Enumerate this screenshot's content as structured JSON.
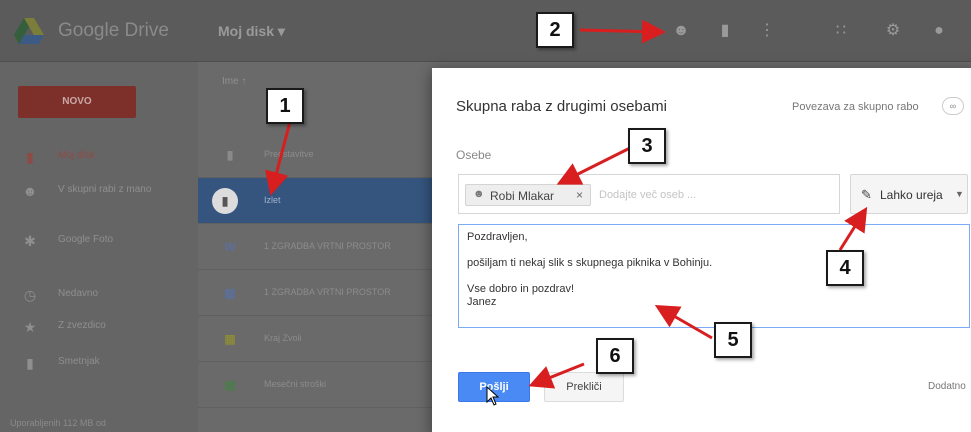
{
  "header": {
    "app_title": "Google Drive",
    "breadcrumb": "Moj disk ▾"
  },
  "sidebar": {
    "new_button": "NOVO",
    "items": [
      {
        "label": "Moj disk",
        "icon": "drive-icon",
        "active": true
      },
      {
        "label": "V skupni rabi z mano",
        "icon": "people-icon",
        "active": false
      },
      {
        "label": "Google Foto",
        "icon": "photos-icon",
        "active": false
      },
      {
        "label": "Nedavno",
        "icon": "clock-icon",
        "active": false
      },
      {
        "label": "Z zvezdico",
        "icon": "star-icon",
        "active": false
      },
      {
        "label": "Smetnjak",
        "icon": "trash-icon",
        "active": false
      }
    ],
    "storage": "Uporabljenih 112 MB od"
  },
  "file_list": {
    "column_header": "Ime ↑",
    "rows": [
      {
        "name": "Predstavitve",
        "icon": "folder-icon",
        "selected": false
      },
      {
        "name": "Izlet",
        "icon": "folder-icon",
        "selected": true
      },
      {
        "name": "1 ZGRADBA VRTNI PROSTOR",
        "icon": "word-doc-icon",
        "selected": false
      },
      {
        "name": "1 ZGRADBA VRTNI PROSTOR",
        "icon": "doc-icon",
        "selected": false
      },
      {
        "name": "Kraj Zvoli",
        "icon": "sheet-icon",
        "selected": false
      },
      {
        "name": "Mesečni stroški",
        "icon": "sheet-icon",
        "selected": false
      }
    ]
  },
  "share_dialog": {
    "title": "Skupna raba z drugimi osebami",
    "link_label": "Povezava za skupno rabo",
    "people_label": "Osebe",
    "chip_name": "Robi Mlakar",
    "add_people_placeholder": "Dodajte več oseb ...",
    "permission": "Lahko ureja",
    "message_lines": [
      "Pozdravljen,",
      "",
      "pošiljam ti nekaj slik s skupnega piknika v Bohinju.",
      "",
      "Vse dobro in pozdrav!",
      "Janez"
    ],
    "send_button": "Pošlji",
    "cancel_button": "Prekliči",
    "advanced": "Dodatno"
  },
  "callouts": [
    "1",
    "2",
    "3",
    "4",
    "5",
    "6"
  ],
  "colors": {
    "send_blue": "#4a8af4",
    "selected_row": "#35557f",
    "arrow_red": "#d81e1e",
    "new_button": "#7d2f2a"
  }
}
